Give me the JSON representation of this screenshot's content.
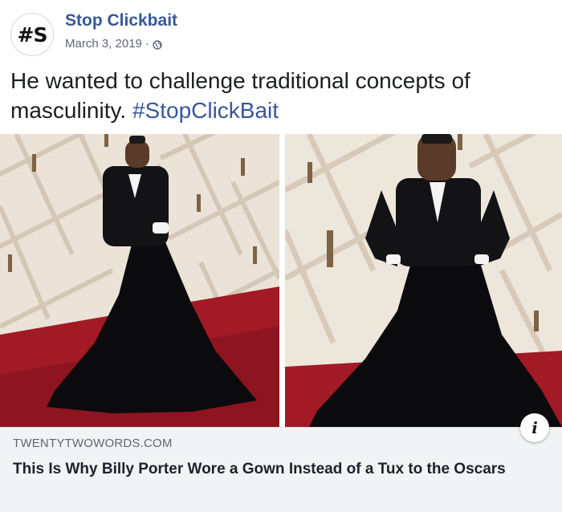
{
  "post": {
    "avatar_text": "#S",
    "page_name": "Stop Clickbait",
    "date": "March 3, 2019",
    "separator": "·",
    "privacy_icon": "globe-icon",
    "text": "He wanted to challenge traditional concepts of masculinity.",
    "hashtag": "#StopClickBait"
  },
  "link_preview": {
    "domain": "TWENTYTWOWORDS.COM",
    "headline": "This Is Why Billy Porter Wore a Gown Instead of a Tux to the Oscars",
    "info_icon": "info-icon",
    "info_glyph": "i"
  },
  "colors": {
    "link_blue": "#385898",
    "carpet_red": "#9b1622",
    "wall_cream": "#ece4d8",
    "gown_black": "#0b0b0d"
  }
}
